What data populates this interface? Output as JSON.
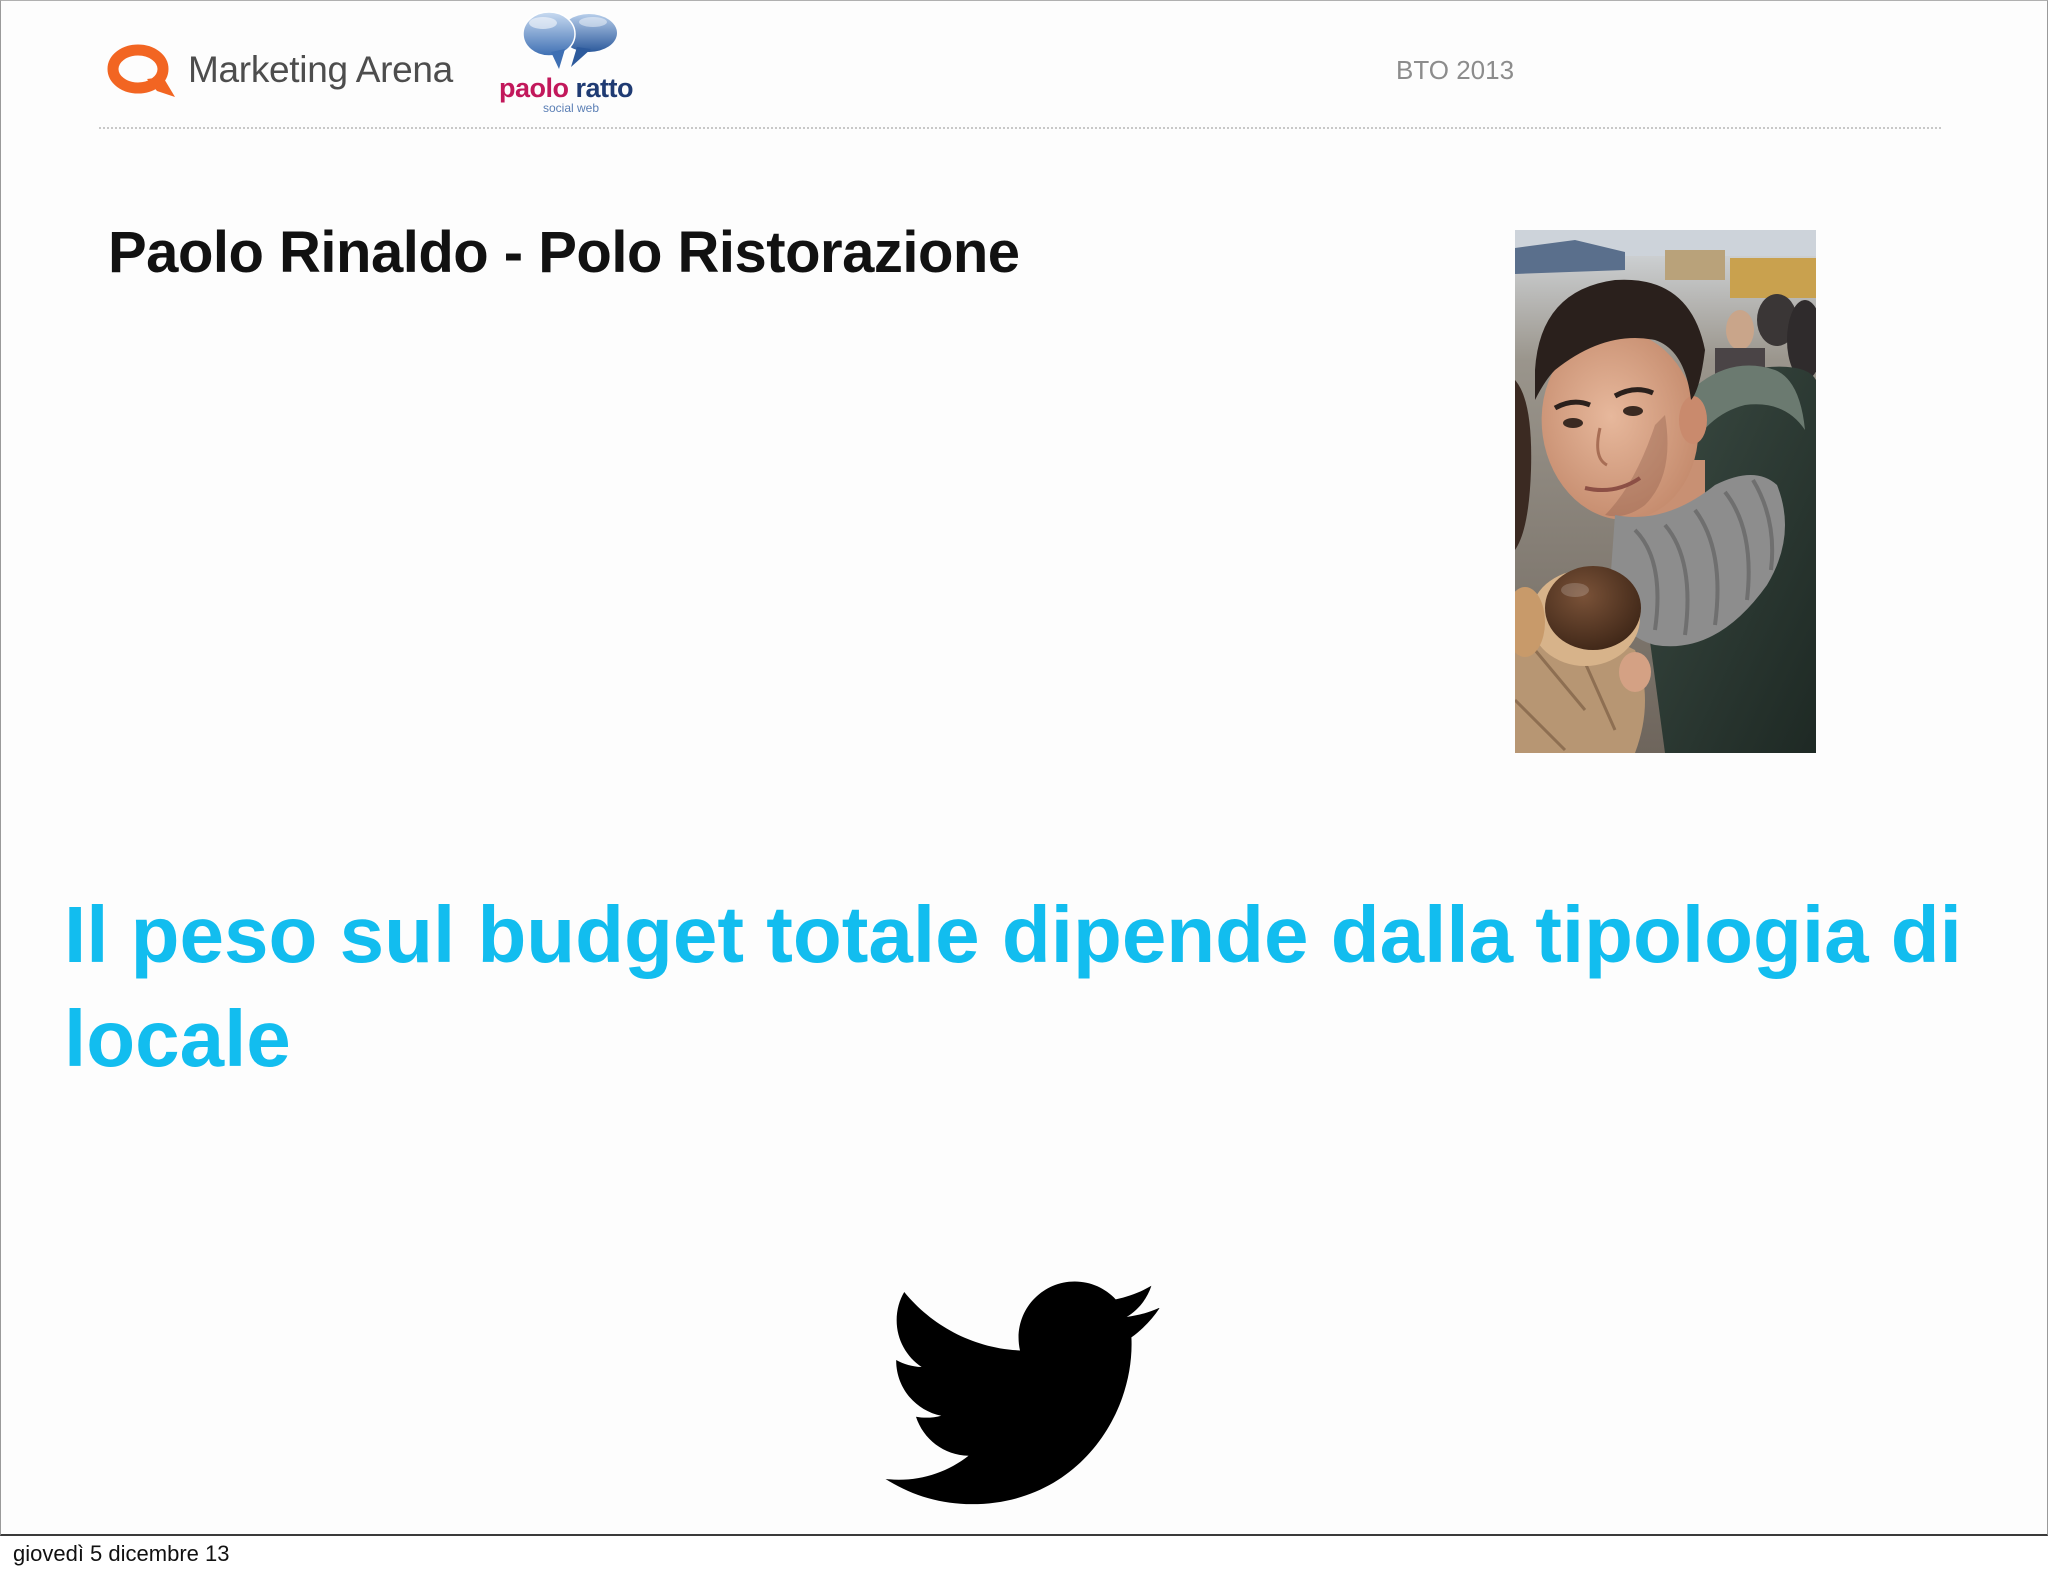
{
  "slide": {
    "header": {
      "marketing_arena_logo": {
        "text": "Marketing Arena",
        "icon": "marketing-arena-q-icon",
        "color": "#f26522"
      },
      "paolo_ratto_logo": {
        "name_first": "paolo",
        "name_second": "ratto",
        "tagline": "social web",
        "icon": "speech-bubbles-icon"
      },
      "event": "BTO 2013"
    },
    "title": "Paolo Rinaldo - Polo Ristorazione",
    "photo": {
      "icon": "portrait-photo"
    },
    "quote": "Il peso sul budget totale dipende dalla tipologia di locale",
    "twitter": {
      "icon": "twitter-bird-icon"
    },
    "colors": {
      "title": "#111111",
      "quote": "#12bdef",
      "event": "#8c8c8c",
      "logo_accent": "#f26522"
    }
  },
  "footer": {
    "date": "giovedì 5 dicembre 13"
  }
}
